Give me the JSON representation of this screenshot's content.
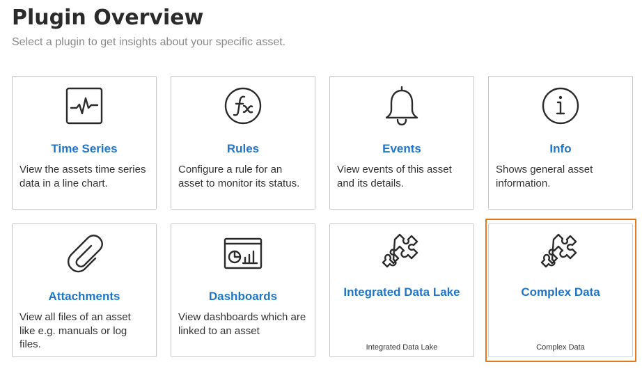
{
  "header": {
    "title": "Plugin Overview",
    "subtitle": "Select a plugin to get insights about your specific asset."
  },
  "plugins": [
    {
      "icon": "time-series-icon",
      "name": "Time Series",
      "description": "View the assets time series data in a line chart."
    },
    {
      "icon": "rules-fx-icon",
      "name": "Rules",
      "description": "Configure a rule for an asset to monitor its status."
    },
    {
      "icon": "bell-icon",
      "name": "Events",
      "description": "View events of this asset and its details."
    },
    {
      "icon": "info-icon",
      "name": "Info",
      "description": "Shows general asset information."
    },
    {
      "icon": "paperclip-icon",
      "name": "Attachments",
      "description": "View all files of an asset like e.g. manuals or log files."
    },
    {
      "icon": "dashboard-icon",
      "name": "Dashboards",
      "description": "View dashboards which are linked to an asset"
    },
    {
      "icon": "puzzle-icon",
      "name": "Integrated Data Lake",
      "footer": "Integrated Data Lake"
    },
    {
      "icon": "puzzle-icon",
      "name": "Complex Data",
      "footer": "Complex Data",
      "selected": true
    }
  ],
  "colors": {
    "link": "#1f76c9",
    "selection_outline": "#e07a1c",
    "card_border": "#c8c8c8"
  }
}
